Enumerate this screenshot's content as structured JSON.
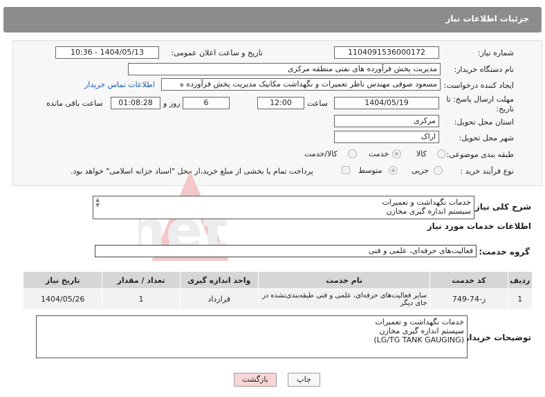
{
  "header": {
    "title": "جزئیات اطلاعات نیاز"
  },
  "form": {
    "need_number_label": "شماره نیاز:",
    "need_number": "1104091536000172",
    "announce_label": "تاریخ و ساعت اعلان عمومی:",
    "announce_value": "1404/05/13 - 10:36",
    "buyer_org_label": "نام دستگاه خریدار:",
    "buyer_org": "مدیریت پخش فرآورده های نفتی منطقه مرکزی",
    "creator_label": "ایجاد کننده درخواست:",
    "creator": "مسعود صوفی مهندس ناظر تعمیرات و نگهداشت مکانیک مدیریت پخش فرآورده ه",
    "contact_link": "اطلاعات تماس خریدار",
    "deadline_label_1": "مهلت ارسال پاسخ: تا",
    "deadline_label_2": "تاریخ:",
    "deadline_date": "1404/05/19",
    "time_label": "ساعت",
    "deadline_time": "12:00",
    "days": "6",
    "days_label": "روز و",
    "remaining": "01:08:28",
    "remaining_label": "ساعت باقی مانده",
    "province_label": "استان محل تحویل:",
    "province": "مرکزی",
    "city_label": "شهر محل تحویل:",
    "city": "اراک",
    "category_label": "طبقه بندی موضوعی:",
    "category_options": [
      "کالا",
      "خدمت",
      "کالا/خدمت"
    ],
    "category_selected": "خدمت",
    "process_label": "نوع فرآیند خرید :",
    "process_options": [
      "جزیی",
      "متوسط"
    ],
    "process_selected": "متوسط",
    "payment_note": "پرداخت تمام یا بخشی از مبلغ خرید،از محل \"اسناد خزانه اسلامی\" خواهد بود."
  },
  "summary": {
    "label": "شرح کلی نیاز:",
    "text": "خدمات نگهداشت و تعمیرات\nسیستم اندازه گیری مخازن"
  },
  "services": {
    "section_title": "اطلاعات خدمات مورد نیاز",
    "group_label": "گروه خدمت:",
    "group_value": "فعالیت‌های حرفه‌ای، علمی و فنی",
    "columns": [
      "ردیف",
      "کد خدمت",
      "نام خدمت",
      "واحد اندازه گیری",
      "تعداد / مقدار",
      "تاریخ نیاز"
    ],
    "rows": [
      [
        "1",
        "ز-74-749",
        "سایر فعالیت‌های حرفه‌ای، علمی و فنی طبقه‌بندی‌نشده در جای دیگر",
        "قرارداد",
        "1",
        "1404/05/26"
      ]
    ]
  },
  "buyer_notes": {
    "label": "توضیحات خریدار:",
    "text": "خدمات نگهداشت و تعمیرات\nسیستم اندازه گیری مخازن\n(LG/TG TANK GAUGING)"
  },
  "buttons": {
    "print": "چاپ",
    "back": "بازگشت"
  },
  "colors": {
    "header_bg": "#8c8c8c",
    "back_button_bg": "#f9d6d6",
    "link": "#1a5fb4"
  }
}
